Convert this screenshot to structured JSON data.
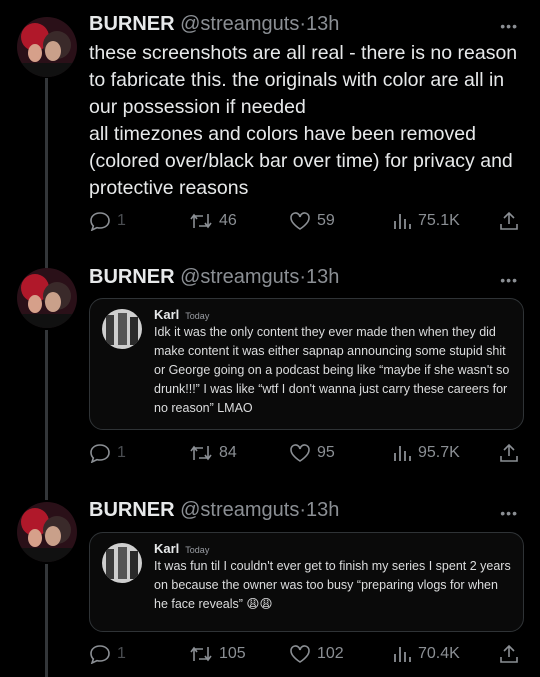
{
  "tweets": [
    {
      "name": "BURNER",
      "handle": "@streamguts",
      "time": "13h",
      "more": "•••",
      "text": "these screenshots are all real - there is no reason to fabricate this. the originals with color are all in our possession if needed\nall timezones and colors have been removed (colored over/black bar over time) for privacy and protective reasons",
      "replies": "1",
      "retweets": "46",
      "likes": "59",
      "views": "75.1K"
    },
    {
      "name": "BURNER",
      "handle": "@streamguts",
      "time": "13h",
      "more": "•••",
      "card": {
        "author": "Karl",
        "time": "Today",
        "text": "Idk it was the only content they ever made then when they did make content it was either sapnap announcing some stupid shit or George going on a podcast being like “maybe if she wasn't so drunk!!!” I was like “wtf I don't wanna just carry these careers for no reason” LMAO"
      },
      "replies": "1",
      "retweets": "84",
      "likes": "95",
      "views": "95.7K"
    },
    {
      "name": "BURNER",
      "handle": "@streamguts",
      "time": "13h",
      "more": "•••",
      "card": {
        "author": "Karl",
        "time": "Today",
        "text": "It was fun til I couldn't ever get to finish my series I spent 2 years on because the owner was too busy “preparing vlogs for when he face reveals” 😩😩"
      },
      "replies": "1",
      "retweets": "105",
      "likes": "102",
      "views": "70.4K"
    }
  ],
  "colors": {
    "background": "#000000",
    "text": "#e7e9ea",
    "muted": "#8b8f94",
    "border": "#2f3336"
  }
}
